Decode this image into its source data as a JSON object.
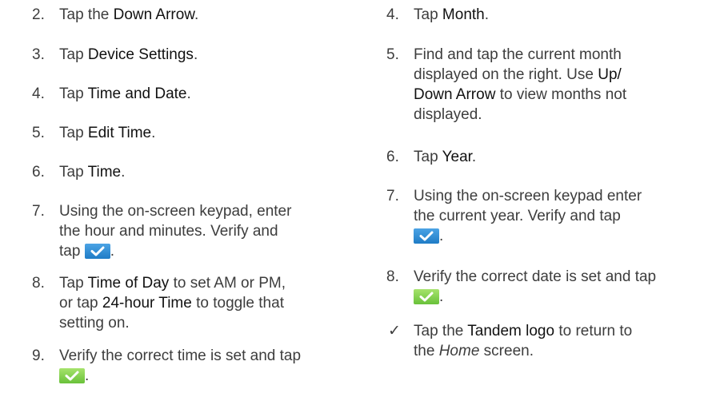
{
  "left_steps": [
    {
      "num": "2.",
      "lines": [
        [
          "Tap the ",
          "Down Arrow",
          "."
        ]
      ]
    },
    {
      "num": "3.",
      "lines": [
        [
          "Tap ",
          "Device Settings",
          "."
        ]
      ]
    },
    {
      "num": "4.",
      "lines": [
        [
          "Tap ",
          "Time and Date",
          "."
        ]
      ]
    },
    {
      "num": "5.",
      "lines": [
        [
          "Tap ",
          "Edit Time",
          "."
        ]
      ]
    },
    {
      "num": "6.",
      "lines": [
        [
          "Tap ",
          "Time",
          "."
        ]
      ]
    },
    {
      "num": "7.",
      "line1": "Using the on-screen keypad, enter",
      "line2": "the hour and minutes. Verify and",
      "line3_prefix": "tap",
      "line3_suffix": "."
    },
    {
      "num": "8.",
      "line1_prefix": "Tap ",
      "line1_em": "Time of Day",
      "line1_suffix": " to set AM or PM,",
      "line2_prefix": "or tap ",
      "line2_em": "24-hour Time",
      "line2_suffix": " to toggle that",
      "line3": "setting on."
    },
    {
      "num": "9.",
      "line1": "Verify the correct time is set and tap",
      "line2_suffix": "."
    }
  ],
  "right_steps": [
    {
      "num": "4.",
      "prefix": "Tap ",
      "em": "Month",
      "suffix": "."
    },
    {
      "num": "5.",
      "line1": "Find and tap the current month",
      "line2_prefix": "displayed on the right. Use ",
      "line2_em": "Up/",
      "line3_em": "Down Arrow",
      "line3_suffix": " to view months not",
      "line4": "displayed."
    },
    {
      "num": "6.",
      "prefix": "Tap ",
      "em": "Year",
      "suffix": "."
    },
    {
      "num": "7.",
      "line1": "Using the on-screen keypad enter",
      "line2": "the current year. Verify and tap",
      "line3_suffix": "."
    },
    {
      "num": "8.",
      "line1": "Verify the correct date is set and tap",
      "line2_suffix": "."
    },
    {
      "num": "✓",
      "line1_prefix": "Tap the ",
      "line1_em": "Tandem logo",
      "line1_suffix": " to return to",
      "line2_prefix": "the ",
      "line2_it": "Home",
      "line2_suffix": " screen."
    }
  ],
  "icons": {
    "blue_button": "checkmark-button-icon",
    "green_button": "checkmark-confirm-icon"
  },
  "colors": {
    "text": "#3d3d3d",
    "blue_button": "#2f8fd6",
    "green_button": "#83d04f"
  }
}
